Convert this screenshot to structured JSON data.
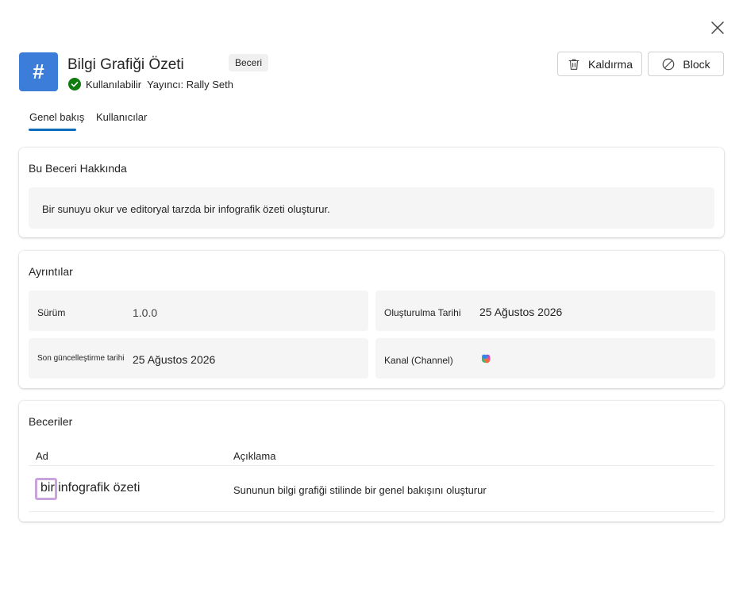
{
  "header": {
    "icon_glyph": "#",
    "title": "Bilgi Grafiği Özeti",
    "type_badge": "Beceri",
    "status": "Kullanılabilir",
    "publisher": "Yayıncı: Rally Seth",
    "remove_label": "Kaldırma",
    "block_label": "Block",
    "accent_color": "#3b7dd8"
  },
  "tabs": [
    {
      "label": "Genel bakış",
      "selected": true
    },
    {
      "label": "Kullanıcılar",
      "selected": false
    }
  ],
  "about": {
    "title": "Bu Beceri Hakkında",
    "description": "Bir sunuyu okur ve editoryal tarzda bir infografik özeti oluşturur."
  },
  "details": {
    "title": "Ayrıntılar",
    "version_label": "Sürüm",
    "version_value": "1.0.0",
    "created_label": "Oluşturulma Tarihi",
    "created_value": "25 Ağustos 2026",
    "updated_label": "Son güncelleştirme tarihi",
    "updated_value": "25 Ağustos 2026",
    "channel_label": "Kanal (Channel)",
    "channel_icon": "copilot-icon"
  },
  "skills": {
    "title": "Beceriler",
    "col_name": "Ad",
    "col_desc": "Açıklama",
    "rows": [
      {
        "name": "bir infografik özeti",
        "description": "Sununun bilgi grafiği stilinde bir genel bakışını oluşturur"
      }
    ]
  }
}
